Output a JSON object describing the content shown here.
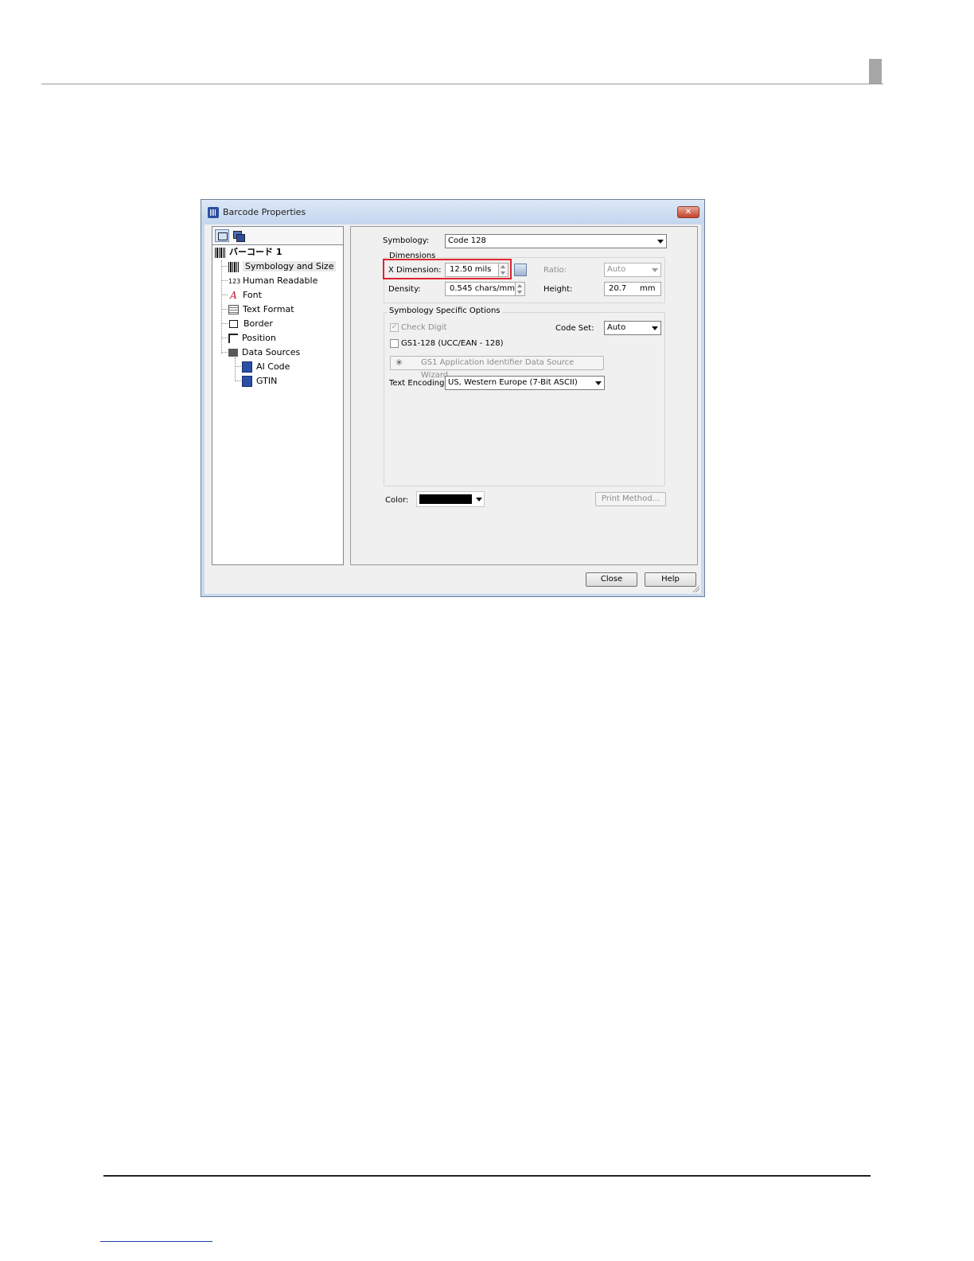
{
  "dialog": {
    "title": "Barcode Properties",
    "close_glyph": "✕"
  },
  "tree": {
    "root": "バーコード 1",
    "items": [
      {
        "label": "Symbology and Size",
        "icon": "barcode-icon"
      },
      {
        "label": "Human Readable",
        "icon": "numbers-icon",
        "icon_text": "123"
      },
      {
        "label": "Font",
        "icon": "font-icon",
        "icon_text": "A"
      },
      {
        "label": "Text Format",
        "icon": "text-format-icon"
      },
      {
        "label": "Border",
        "icon": "border-icon"
      },
      {
        "label": "Position",
        "icon": "position-icon"
      },
      {
        "label": "Data Sources",
        "icon": "data-sources-icon"
      }
    ],
    "children": [
      {
        "label": "AI Code",
        "icon": "data-field-icon"
      },
      {
        "label": "GTIN",
        "icon": "data-field-icon"
      }
    ]
  },
  "settings": {
    "symbology_label": "Symbology:",
    "symbology_value": "Code 128",
    "dimensions": {
      "title": "Dimensions",
      "x_dimension_label": "X Dimension:",
      "x_dimension_value": "12.50  mils",
      "density_label": "Density:",
      "density_value": "0.545  chars/mm",
      "ratio_label": "Ratio:",
      "ratio_value": "Auto",
      "height_label": "Height:",
      "height_value": "20.7",
      "height_unit": "mm"
    },
    "symbology_options": {
      "title": "Symbology Specific Options",
      "check_digit_label": "Check Digit",
      "check_digit_checked": true,
      "code_set_label": "Code Set:",
      "code_set_value": "Auto",
      "gs1_label": "GS1-128 (UCC/EAN - 128)",
      "gs1_checked": false,
      "wizard_label": "GS1 Application Identifier Data Source Wizard...",
      "text_encoding_label": "Text Encoding:",
      "text_encoding_value": "US, Western Europe (7-Bit ASCII)"
    },
    "color_label": "Color:",
    "color_value": "#000000",
    "print_method_label": "Print Method..."
  },
  "buttons": {
    "close_label": "Close",
    "help_label": "Help"
  }
}
